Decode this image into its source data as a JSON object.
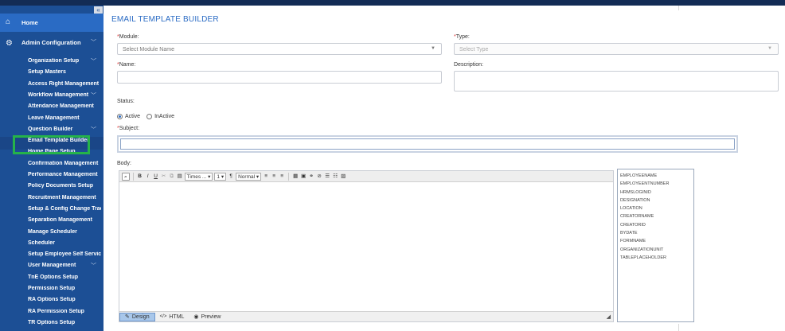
{
  "sidebar": {
    "collapse_glyph": "«",
    "home_label": "Home",
    "admin_label": "Admin Configuration",
    "items": [
      {
        "label": "Organization Setup",
        "expandable": true
      },
      {
        "label": "Setup Masters",
        "expandable": false
      },
      {
        "label": "Access Right Management",
        "expandable": false
      },
      {
        "label": "Workflow Management",
        "expandable": true
      },
      {
        "label": "Attendance Management",
        "expandable": false
      },
      {
        "label": "Leave Management",
        "expandable": false
      },
      {
        "label": "Question Builder",
        "expandable": true
      },
      {
        "label": "Email Template Builder",
        "expandable": false
      },
      {
        "label": "Home Page Setup",
        "expandable": false
      },
      {
        "label": "Confirmation Management",
        "expandable": false
      },
      {
        "label": "Performance Management",
        "expandable": false
      },
      {
        "label": "Policy Documents Setup",
        "expandable": false
      },
      {
        "label": "Recruitment Management",
        "expandable": false
      },
      {
        "label": "Setup & Config Change Trac...",
        "expandable": false
      },
      {
        "label": "Separation Management",
        "expandable": false
      },
      {
        "label": "Manage Scheduler",
        "expandable": false
      },
      {
        "label": "Scheduler",
        "expandable": false
      },
      {
        "label": "Setup Employee Self Service",
        "expandable": false
      },
      {
        "label": "User Management",
        "expandable": true
      },
      {
        "label": "TnE Options Setup",
        "expandable": false
      },
      {
        "label": "Permission Setup",
        "expandable": false
      },
      {
        "label": "RA Options Setup",
        "expandable": false
      },
      {
        "label": "RA Permission Setup",
        "expandable": false
      },
      {
        "label": "TR Options Setup",
        "expandable": false
      }
    ],
    "active_item": "Email Template Builder"
  },
  "main": {
    "title": "EMAIL TEMPLATE BUILDER",
    "module_label": "Module:",
    "module_placeholder": "Select Module Name",
    "type_label": "Type:",
    "type_placeholder": "Select Type",
    "name_label": "Name:",
    "description_label": "Description:",
    "status_label": "Status:",
    "status_active": "Active",
    "status_inactive": "InActive",
    "subject_label": "Subject:",
    "body_label": "Body:",
    "required_mark": "*",
    "toolbar": {
      "font_family": "Times ...",
      "font_size": "1",
      "format": "Normal"
    },
    "modes": {
      "design": "Design",
      "html": "HTML",
      "preview": "Preview"
    },
    "placeholders": [
      "EMPLOYEENAME",
      "EMPLOYEENTNUMBER",
      "HRMSLOGINID",
      "DESIGNATION",
      "LOCATION",
      "CREATORNAME",
      "CREATORID",
      "BYDATE",
      "FORMNAME",
      "ORGANIZATIONUNIT",
      "TABLEPLACEHOLDER"
    ]
  },
  "colors": {
    "sidebar": "#1c4f95",
    "accent": "#2a6bc4",
    "highlight": "#25b34a",
    "topbar": "#132c55"
  }
}
